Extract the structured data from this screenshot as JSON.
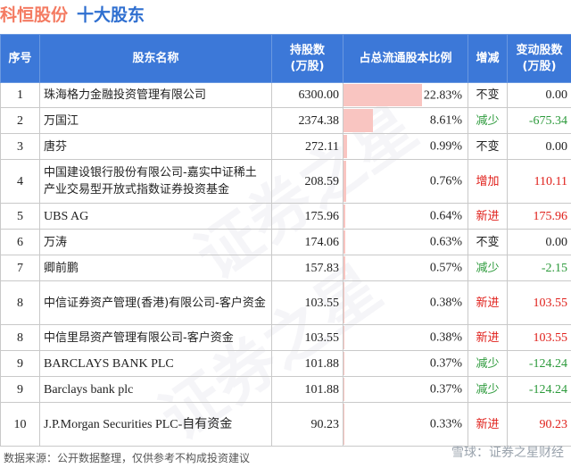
{
  "title": {
    "company": "科恒股份",
    "subtitle": "十大股东"
  },
  "headers": {
    "idx": "序号",
    "name": "股东名称",
    "shares_l1": "持股数",
    "shares_l2": "(万股)",
    "ratio": "占总流通股本比例",
    "change": "增减",
    "delta_l1": "变动股数",
    "delta_l2": "(万股)"
  },
  "rows": [
    {
      "idx": "1",
      "name": "珠海格力金融投资管理有限公司",
      "shares": "6300.00",
      "ratio": "22.83%",
      "ratio_value": 22.83,
      "change": "不变",
      "change_type": "same",
      "delta": "0.00"
    },
    {
      "idx": "2",
      "name": "万国江",
      "shares": "2374.38",
      "ratio": "8.61%",
      "ratio_value": 8.61,
      "change": "减少",
      "change_type": "down",
      "delta": "-675.34"
    },
    {
      "idx": "3",
      "name": "唐芬",
      "shares": "272.11",
      "ratio": "0.99%",
      "ratio_value": 0.99,
      "change": "不变",
      "change_type": "same",
      "delta": "0.00"
    },
    {
      "idx": "4",
      "name": "中国建设银行股份有限公司-嘉实中证稀土产业交易型开放式指数证券投资基金",
      "shares": "208.59",
      "ratio": "0.76%",
      "ratio_value": 0.76,
      "change": "增加",
      "change_type": "up",
      "delta": "110.11"
    },
    {
      "idx": "5",
      "name": "UBS AG",
      "shares": "175.96",
      "ratio": "0.64%",
      "ratio_value": 0.64,
      "change": "新进",
      "change_type": "up",
      "delta": "175.96"
    },
    {
      "idx": "6",
      "name": "万涛",
      "shares": "174.06",
      "ratio": "0.63%",
      "ratio_value": 0.63,
      "change": "不变",
      "change_type": "same",
      "delta": "0.00"
    },
    {
      "idx": "7",
      "name": "卿前鹏",
      "shares": "157.83",
      "ratio": "0.57%",
      "ratio_value": 0.57,
      "change": "减少",
      "change_type": "down",
      "delta": "-2.15"
    },
    {
      "idx": "8",
      "name": "中信证券资产管理(香港)有限公司-客户资金",
      "shares": "103.55",
      "ratio": "0.38%",
      "ratio_value": 0.38,
      "change": "新进",
      "change_type": "up",
      "delta": "103.55"
    },
    {
      "idx": "8",
      "name": "中信里昂资产管理有限公司-客户资金",
      "shares": "103.55",
      "ratio": "0.38%",
      "ratio_value": 0.38,
      "change": "新进",
      "change_type": "up",
      "delta": "103.55"
    },
    {
      "idx": "9",
      "name": "BARCLAYS BANK PLC",
      "shares": "101.88",
      "ratio": "0.37%",
      "ratio_value": 0.37,
      "change": "减少",
      "change_type": "down",
      "delta": "-124.24"
    },
    {
      "idx": "9",
      "name": "Barclays bank plc",
      "shares": "101.88",
      "ratio": "0.37%",
      "ratio_value": 0.37,
      "change": "减少",
      "change_type": "down",
      "delta": "-124.24"
    },
    {
      "idx": "10",
      "name": "J.P.Morgan Securities PLC-自有资金",
      "shares": "90.23",
      "ratio": "0.33%",
      "ratio_value": 0.33,
      "change": "新进",
      "change_type": "up",
      "delta": "90.23"
    }
  ],
  "footer": "数据来源：公开数据整理，仅供参考不构成投资建议",
  "brand": "雪球：证券之星财经",
  "colors": {
    "header_bg": "#3c78d8",
    "bar": "#f9c5c1",
    "up": "#e0201b",
    "down": "#2c9a3b",
    "title": "#f47b62",
    "subtitle": "#2f6fd0"
  }
}
